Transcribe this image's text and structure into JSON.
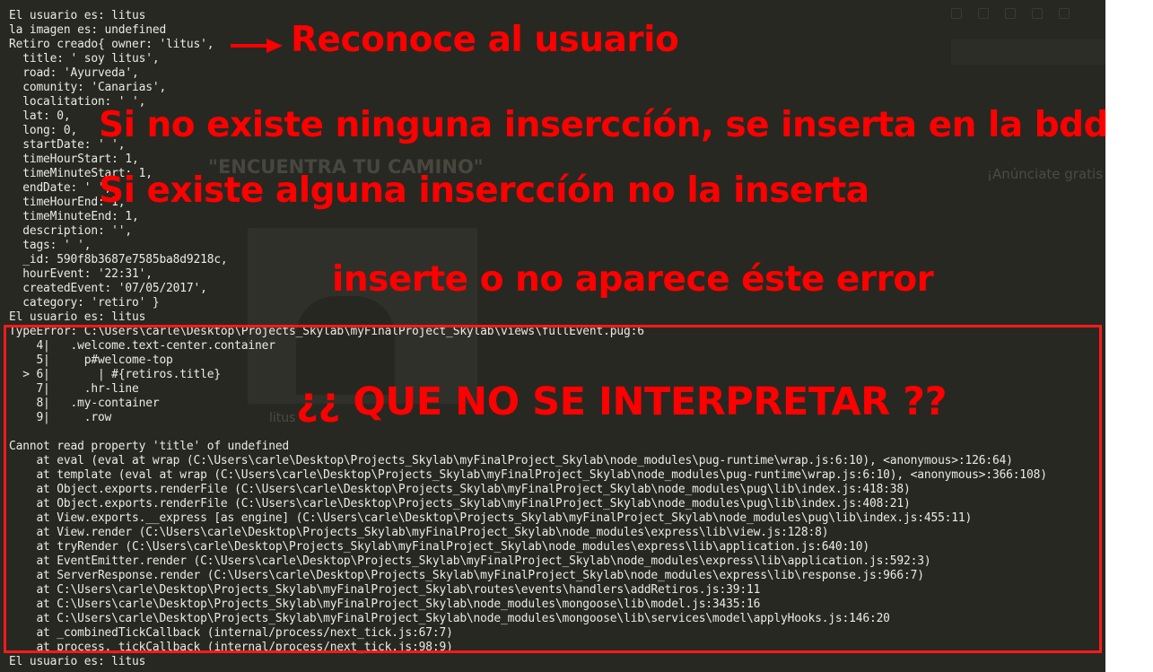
{
  "colors": {
    "terminal_bg": "#272822",
    "terminal_text": "#ecebe2",
    "annotation": "#ff0000"
  },
  "terminal": {
    "lines": [
      "El usuario es: litus",
      "la imagen es: undefined",
      "Retiro creado{ owner: 'litus',",
      "  title: ' soy litus',",
      "  road: 'Ayurveda',",
      "  comunity: 'Canarias',",
      "  localitation: ' ',",
      "  lat: 0,",
      "  long: 0,",
      "  startDate: ' ',",
      "  timeHourStart: 1,",
      "  timeMinuteStart: 1,",
      "  endDate: ' ',",
      "  timeHourEnd: 1,",
      "  timeMinuteEnd: 1,",
      "  description: '',",
      "  tags: ' ',",
      "  _id: 590f8b3687e7585ba8d9218c,",
      "  hourEvent: '22:31',",
      "  createdEvent: '07/05/2017',",
      "  category: 'retiro' }",
      "El usuario es: litus",
      "TypeError: C:\\Users\\carle\\Desktop\\Projects_Skylab\\myFinalProject_Skylab\\views\\fullEvent.pug:6",
      "    4|   .welcome.text-center.container",
      "    5|     p#welcome-top",
      "  > 6|       | #{retiros.title}",
      "    7|     .hr-line",
      "    8|   .my-container",
      "    9|     .row",
      "",
      "Cannot read property 'title' of undefined",
      "    at eval (eval at wrap (C:\\Users\\carle\\Desktop\\Projects_Skylab\\myFinalProject_Skylab\\node_modules\\pug-runtime\\wrap.js:6:10), <anonymous>:126:64)",
      "    at template (eval at wrap (C:\\Users\\carle\\Desktop\\Projects_Skylab\\myFinalProject_Skylab\\node_modules\\pug-runtime\\wrap.js:6:10), <anonymous>:366:108)",
      "    at Object.exports.renderFile (C:\\Users\\carle\\Desktop\\Projects_Skylab\\myFinalProject_Skylab\\node_modules\\pug\\lib\\index.js:418:38)",
      "    at Object.exports.renderFile (C:\\Users\\carle\\Desktop\\Projects_Skylab\\myFinalProject_Skylab\\node_modules\\pug\\lib\\index.js:408:21)",
      "    at View.exports.__express [as engine] (C:\\Users\\carle\\Desktop\\Projects_Skylab\\myFinalProject_Skylab\\node_modules\\pug\\lib\\index.js:455:11)",
      "    at View.render (C:\\Users\\carle\\Desktop\\Projects_Skylab\\myFinalProject_Skylab\\node_modules\\express\\lib\\view.js:128:8)",
      "    at tryRender (C:\\Users\\carle\\Desktop\\Projects_Skylab\\myFinalProject_Skylab\\node_modules\\express\\lib\\application.js:640:10)",
      "    at EventEmitter.render (C:\\Users\\carle\\Desktop\\Projects_Skylab\\myFinalProject_Skylab\\node_modules\\express\\lib\\application.js:592:3)",
      "    at ServerResponse.render (C:\\Users\\carle\\Desktop\\Projects_Skylab\\myFinalProject_Skylab\\node_modules\\express\\lib\\response.js:966:7)",
      "    at C:\\Users\\carle\\Desktop\\Projects_Skylab\\myFinalProject_Skylab\\routes\\events\\handlers\\addRetiros.js:39:11",
      "    at C:\\Users\\carle\\Desktop\\Projects_Skylab\\myFinalProject_Skylab\\node_modules\\mongoose\\lib\\model.js:3435:16",
      "    at C:\\Users\\carle\\Desktop\\Projects_Skylab\\myFinalProject_Skylab\\node_modules\\mongoose\\lib\\services\\model\\applyHooks.js:146:20",
      "    at _combinedTickCallback (internal/process/next_tick.js:67:7)",
      "    at process._tickCallback (internal/process/next_tick.js:98:9)",
      "El usuario es: litus"
    ]
  },
  "annotations": {
    "user": "Reconoce al usuario",
    "insert": "Si no existe ninguna inserccíón, se inserta en la bdd",
    "noinsert": "Si existe alguna inserccíón no la inserta",
    "error": "inserte o no aparece éste error",
    "question": "¿¿ QUE NO SE INTERPRETAR ??"
  },
  "background": {
    "heading": "\"ENCUENTRA TU CAMINO\"",
    "side_text": "¡Anúnciate gratis",
    "caption": "litus"
  }
}
